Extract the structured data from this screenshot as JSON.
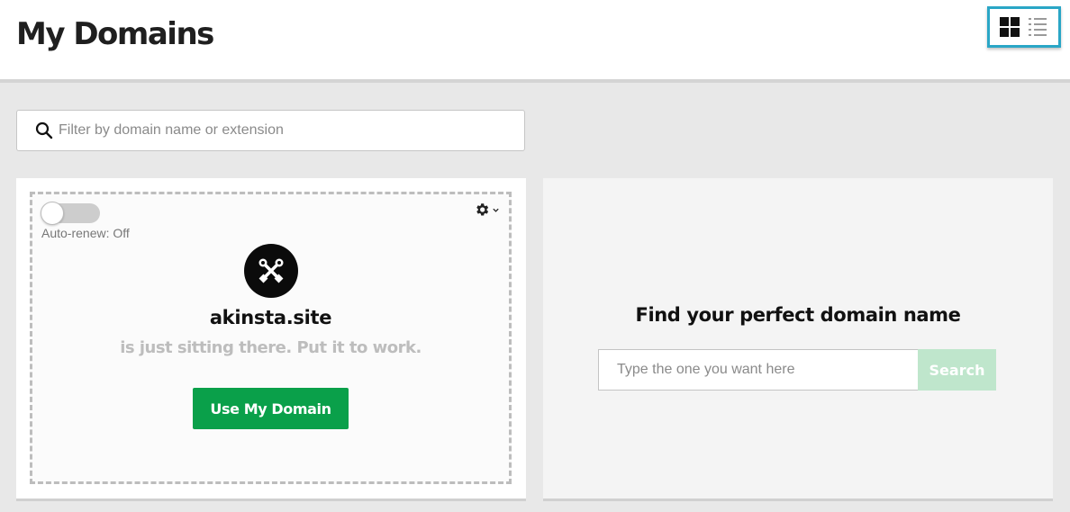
{
  "header": {
    "title": "My Domains"
  },
  "view_toggle": {
    "active": "grid-view",
    "options": [
      "grid-view",
      "list-view"
    ]
  },
  "filter": {
    "placeholder": "Filter by domain name or extension",
    "icon": "search-icon"
  },
  "domain_card": {
    "auto_renew_label": "Auto-renew: Off",
    "auto_renew_on": false,
    "settings_icon": "gear-icon",
    "settings_dropdown_icon": "chevron-down-icon",
    "status_icon": "tools-icon",
    "domain": "akinsta.site",
    "subtitle": "is just sitting there. Put it to work.",
    "cta_label": "Use My Domain"
  },
  "find_card": {
    "title": "Find your perfect domain name",
    "input_placeholder": "Type the one you want here",
    "search_label": "Search"
  },
  "colors": {
    "accent_cyan": "#2aa6c6",
    "primary_green": "#0aa04a",
    "disabled_green": "#bfe6cc"
  }
}
